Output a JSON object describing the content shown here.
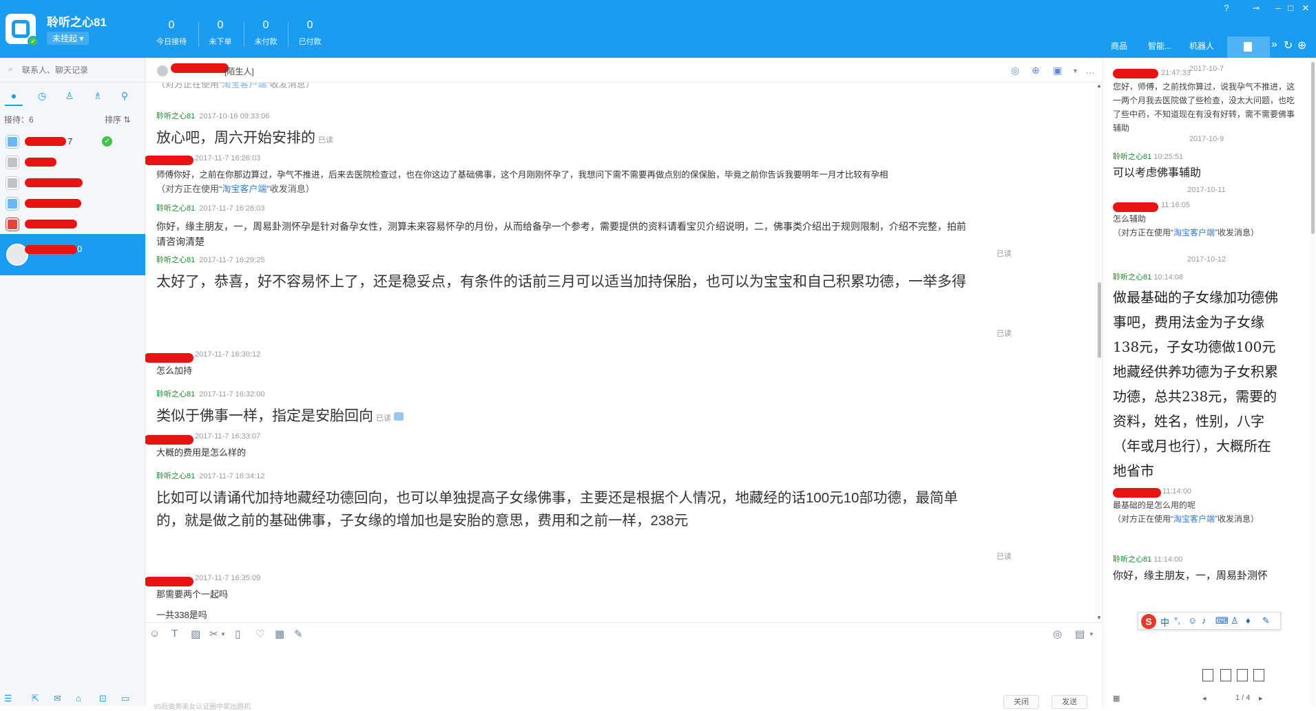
{
  "app": {
    "shop_name": "聆听之心81",
    "status": "未挂起",
    "stats": [
      {
        "value": "0",
        "label": "今日接待"
      },
      {
        "value": "0",
        "label": "未下单"
      },
      {
        "value": "0",
        "label": "未付款"
      },
      {
        "value": "0",
        "label": "已付款"
      }
    ],
    "right_tabs": [
      "商品",
      "智能...",
      "机器人"
    ]
  },
  "sidebar": {
    "search_placeholder": "联系人、聊天记录",
    "reception_count": "接待：6",
    "sort_label": "排序 ⇅",
    "contacts": [
      {
        "name": "7"
      },
      {
        "name": ""
      },
      {
        "name": ""
      },
      {
        "name": ""
      },
      {
        "name": ""
      },
      {
        "name": "0"
      }
    ]
  },
  "chat": {
    "stranger_tag": "[陌生人]",
    "messages": [
      {
        "sender": "聆听之心81",
        "time": "2017-10-16 09:33:06",
        "text": "放心吧，周六开始安排的",
        "read": "已读"
      },
      {
        "sender": "",
        "time": "2017-11-7 16:26:03",
        "text": "师傅你好，之前在你那边算过，孕气不推进，后来去医院检查过，也在你这边了基础佛事，这个月刚刚怀孕了，我想问下需不需要再做点别的保保胎，毕竟之前你告诉我要明年一月才比较有孕相",
        "note_prefix": "（对方正在使用“",
        "note_link": "淘宝客户端",
        "note_suffix": "”收发消息）"
      },
      {
        "sender": "聆听之心81",
        "time": "2017-11-7 16:26:03",
        "text": "你好，缘主朋友，一，周易卦测怀孕是针对备孕女性，测算未来容易怀孕的月份，从而给备孕一个参考，需要提供的资料请看宝贝介绍说明，二，佛事类介绍出于规则限制，介绍不完整，拍前请咨询清楚",
        "read": "已读"
      },
      {
        "sender": "聆听之心81",
        "time": "2017-11-7 16:29:25",
        "text": "太好了，恭喜，好不容易怀上了，还是稳妥点，有条件的话前三月可以适当加持保胎，也可以为宝宝和自己积累功德，一举多得",
        "read": "已读"
      },
      {
        "sender": "",
        "time": "2017-11-7 16:30:12",
        "text": "怎么加持"
      },
      {
        "sender": "聆听之心81",
        "time": "2017-11-7 16:32:00",
        "text": "类似于佛事一样，指定是安胎回向",
        "read": "已读"
      },
      {
        "sender": "",
        "time": "2017-11-7 16:33:07",
        "text": "大概的费用是怎么样的"
      },
      {
        "sender": "聆听之心81",
        "time": "2017-11-7 16:34:12",
        "text": "比如可以请诵代加持地藏经功德回向，也可以单独提高子女缘佛事，主要还是根据个人情况，地藏经的话100元10部功德，最简单的，就是做之前的基础佛事，子女缘的增加也是安胎的意思，费用和之前一样，238元",
        "read": "已读"
      },
      {
        "sender": "",
        "time": "2017-11-7 16:35:09",
        "text": "那需要两个一起吗"
      },
      {
        "text": "一共338是吗"
      }
    ],
    "input_placeholder": "95后做男美女认证圈中奖出题机",
    "close_label": "关闭",
    "send_label": "发送"
  },
  "history": {
    "entries": [
      {
        "date": "2017-10-7"
      },
      {
        "sender": "",
        "time": "21:47:33",
        "text": "您好，师傅，之前找你算过，说我孕气不推进，这一两个月我去医院做了些检查，没太大问题，也吃了些中药，不知道现在有没有好转，需不需要佛事辅助"
      },
      {
        "date": "2017-10-9"
      },
      {
        "sender": "聆听之心81",
        "time": "10:25:51",
        "text": "可以考虑佛事辅助"
      },
      {
        "date": "2017-10-11"
      },
      {
        "sender": "",
        "time": "11:16:05",
        "text": "怎么辅助",
        "note_prefix": "（对方正在使用“",
        "note_link": "淘宝客户端",
        "note_suffix": "”收发消息）"
      },
      {
        "date": "2017-10-12"
      },
      {
        "sender": "聆听之心81",
        "time": "10:14:08",
        "text": "做最基础的子女缘加功德佛事吧，费用法金为子女缘138元，子女功德做100元地藏经供养功德为子女积累功德，总共238元，需要的资料，姓名，性别，八字（年或月也行），大概所在地省市"
      },
      {
        "sender": "",
        "time": "11:14:00",
        "text": "最基础的是怎么用的呢",
        "note_prefix": "（对方正在使用“",
        "note_link": "淘宝客户端",
        "note_suffix": "”收发消息）"
      },
      {
        "sender": "聆听之心81",
        "time": "11:14:00",
        "text": "你好，缘主朋友，一，周易卦测怀"
      }
    ],
    "pager": "1 / 4"
  },
  "ime": {
    "label": "中"
  },
  "colors": {
    "brand": "#1a9cf0",
    "sender_green": "#1c8a2b",
    "redaction": "#e81414"
  }
}
